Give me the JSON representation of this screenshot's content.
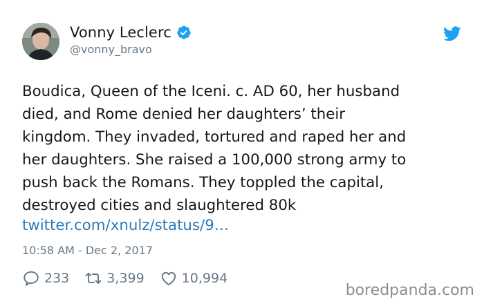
{
  "user": {
    "display_name": "Vonny Leclerc",
    "handle": "@vonny_bravo"
  },
  "tweet": {
    "lines": [
      "Boudica, Queen of the Iceni. c. AD 60, her husband",
      "died, and Rome denied her daughters’ their",
      "kingdom. They invaded, tortured and raped her and",
      "her daughters. She raised a 100,000 strong army to",
      "push back the Romans. They toppled the capital,",
      "destroyed cities and slaughtered 80k"
    ],
    "link": "twitter.com/xnulz/status/9…",
    "timestamp": "10:58 AM - Dec 2, 2017"
  },
  "actions": {
    "replies": "233",
    "retweets": "3,399",
    "likes": "10,994"
  },
  "watermark": "boredpanda.com",
  "colors": {
    "verified": "#1da1f2",
    "bird": "#1da1f2",
    "link": "#2b7bb9",
    "muted": "#657786"
  }
}
